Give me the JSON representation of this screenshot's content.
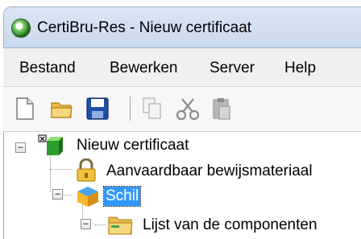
{
  "window": {
    "title": "CertiBru-Res - Nieuw certificaat",
    "icon": "app-globe-icon"
  },
  "menu": {
    "items": [
      "Bestand",
      "Bewerken",
      "Server",
      "Help"
    ]
  },
  "toolbar": {
    "buttons": [
      "new-document-icon",
      "open-folder-icon",
      "save-disk-icon",
      "copy-icon",
      "cut-scissors-icon",
      "paste-icon"
    ]
  },
  "tree": {
    "nodes": [
      {
        "label": "Nieuw certificaat",
        "icon": "cubes-icon",
        "expanded": true
      },
      {
        "label": "Aanvaardbaar bewijsmateriaal",
        "icon": "lock-icon"
      },
      {
        "label": "Schil",
        "icon": "box-icon",
        "expanded": true,
        "selected": true
      },
      {
        "label": "Lijst van de componenten",
        "icon": "folder-icon",
        "expanded": true
      }
    ]
  },
  "colors": {
    "selection": "#3399ff",
    "titlebar": "#c9d9ec"
  }
}
